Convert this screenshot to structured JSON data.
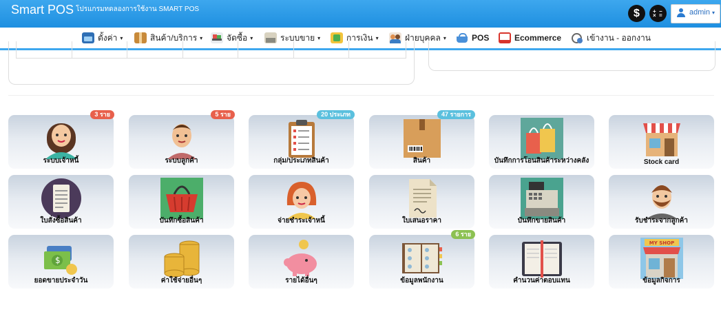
{
  "app": {
    "brand": "Smart POS",
    "subtitle": "โปรแกรมทดลองการใช้งาน SMART POS"
  },
  "header": {
    "currency_symbol": "$",
    "calc_symbols": [
      "+",
      "−",
      "×",
      "="
    ],
    "user_label": "admin"
  },
  "nav": {
    "items": [
      {
        "label": "ตั้งค่า",
        "dropdown": true,
        "icon": "settings-box-icon"
      },
      {
        "label": "สินค้า/บริการ",
        "dropdown": true,
        "icon": "box-icon"
      },
      {
        "label": "จัดซื้อ",
        "dropdown": true,
        "icon": "cart-icon"
      },
      {
        "label": "ระบบขาย",
        "dropdown": true,
        "icon": "register-icon"
      },
      {
        "label": "การเงิน",
        "dropdown": true,
        "icon": "money-icon"
      },
      {
        "label": "ฝ่ายบุคคล",
        "dropdown": true,
        "icon": "people-icon"
      },
      {
        "label": "POS",
        "dropdown": false,
        "icon": "basket-icon"
      },
      {
        "label": "Ecommerce",
        "dropdown": false,
        "icon": "monitor-icon"
      },
      {
        "label": "เข้างาน - ออกงาน",
        "dropdown": false,
        "icon": "clock-person-icon"
      }
    ],
    "caret": "▾"
  },
  "tiles": [
    {
      "label": "ระบบเจ้าหนี้",
      "badge": "3 ราย",
      "badge_color": "#e8604c",
      "icon": "woman-avatar-icon"
    },
    {
      "label": "ระบบลูกค้า",
      "badge": "5 ราย",
      "badge_color": "#e8604c",
      "icon": "man-avatar-icon"
    },
    {
      "label": "กลุ่ม/ประเภทสินค้า",
      "badge": "20 ประเภท",
      "badge_color": "#5bc0de",
      "icon": "clipboard-checklist-icon"
    },
    {
      "label": "สินค้า",
      "badge": "47 รายการ",
      "badge_color": "#5bc0de",
      "icon": "barcode-box-icon"
    },
    {
      "label": "บันทึกการโอนสินค้าระหว่างคลัง",
      "badge": "",
      "badge_color": "",
      "icon": "shopping-bags-icon"
    },
    {
      "label": "Stock card",
      "badge": "",
      "badge_color": "",
      "icon": "storefront-icon"
    },
    {
      "label": "ใบสั่งซื้อสินค้า",
      "badge": "",
      "badge_color": "",
      "icon": "notepad-icon"
    },
    {
      "label": "บันทึกซื้อสินค้า",
      "badge": "",
      "badge_color": "",
      "icon": "basket-icon"
    },
    {
      "label": "จ่ายชำระเจ้าหนี้",
      "badge": "",
      "badge_color": "",
      "icon": "redhead-woman-icon"
    },
    {
      "label": "ใบเสนอราคา",
      "badge": "",
      "badge_color": "",
      "icon": "document-signature-icon"
    },
    {
      "label": "บันทึกขายสินค้า",
      "badge": "",
      "badge_color": "",
      "icon": "cash-register-icon"
    },
    {
      "label": "รับชำระจากลูกค้า",
      "badge": "",
      "badge_color": "",
      "icon": "bearded-man-icon"
    },
    {
      "label": "ยอดขายประจำวัน",
      "badge": "",
      "badge_color": "",
      "icon": "money-cards-icon"
    },
    {
      "label": "ค่าใช้จ่ายอื่นๆ",
      "badge": "",
      "badge_color": "",
      "icon": "coin-stacks-icon"
    },
    {
      "label": "รายได้อื่นๆ",
      "badge": "",
      "badge_color": "",
      "icon": "piggy-bank-icon"
    },
    {
      "label": "ข้อมูลพนักงาน",
      "badge": "6 ราย",
      "badge_color": "#8cc152",
      "icon": "address-book-icon"
    },
    {
      "label": "คำนวนค่าตอบแทน",
      "badge": "",
      "badge_color": "",
      "icon": "notebook-icon"
    },
    {
      "label": "ข้อมูลกิจการ",
      "badge": "",
      "badge_color": "",
      "icon": "my-shop-icon",
      "sign_text": "MY SHOP"
    }
  ]
}
